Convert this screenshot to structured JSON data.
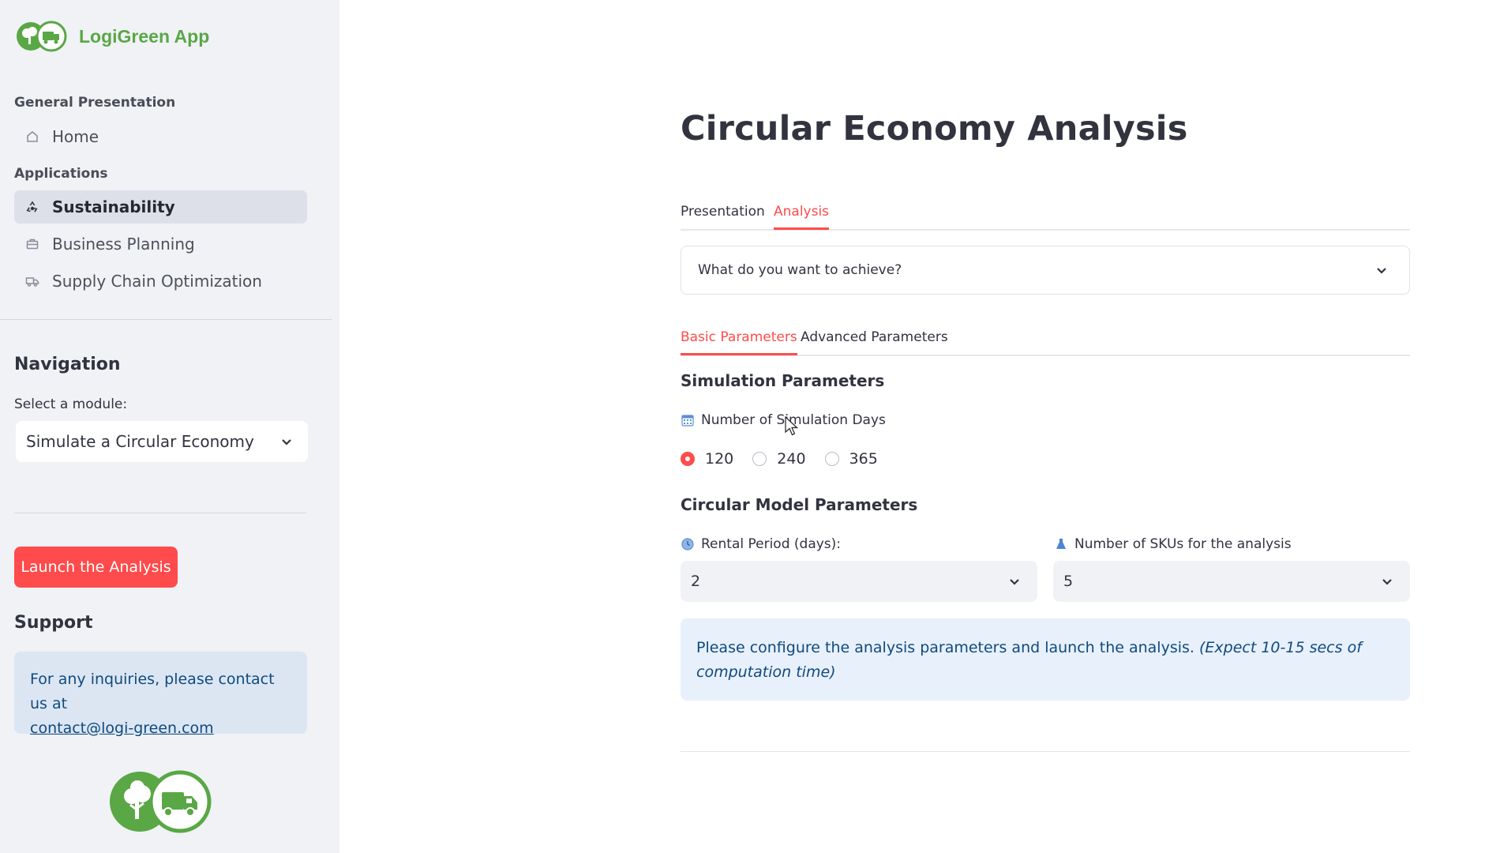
{
  "app": {
    "name": "LogiGreen App"
  },
  "sidebar": {
    "sections": [
      {
        "heading": "General Presentation"
      },
      {
        "heading": "Applications"
      }
    ],
    "items": [
      {
        "label": "Home",
        "icon": "home-icon",
        "active": false
      },
      {
        "label": "Sustainability",
        "icon": "recycle-icon",
        "active": true
      },
      {
        "label": "Business Planning",
        "icon": "briefcase-icon",
        "active": false
      },
      {
        "label": "Supply Chain Optimization",
        "icon": "truck-icon",
        "active": false
      }
    ],
    "navigation": {
      "title": "Navigation",
      "select_label": "Select a module:",
      "selected_module": "Simulate a Circular Economy"
    },
    "launch_label": "Launch the Analysis",
    "support": {
      "title": "Support",
      "text": "For any inquiries, please contact us at",
      "email": "contact@logi-green.com"
    }
  },
  "main": {
    "title": "Circular Economy Analysis",
    "tabs": [
      {
        "label": "Presentation",
        "active": false
      },
      {
        "label": "Analysis",
        "active": true
      }
    ],
    "expander": {
      "label": "What do you want to achieve?"
    },
    "param_tabs": [
      {
        "label": "Basic Parameters",
        "active": true
      },
      {
        "label": "Advanced Parameters",
        "active": false
      }
    ],
    "simulation": {
      "title": "Simulation Parameters",
      "days_label": "Number of Simulation Days",
      "options": [
        "120",
        "240",
        "365"
      ],
      "selected": "120"
    },
    "circular": {
      "title": "Circular Model Parameters",
      "rental_label": "Rental Period (days):",
      "rental_value": "2",
      "sku_label": "Number of SKUs for the analysis",
      "sku_value": "5"
    },
    "info": {
      "text": "Please configure the analysis parameters and launch the analysis.",
      "note": "(Expect 10-15 secs of computation time)"
    }
  },
  "colors": {
    "accent": "#ff4b4b",
    "brand_green": "#5aa745",
    "sidebar_bg": "#f0f2f6",
    "info_text": "#0f4a7f",
    "info_bg": "#e8f0fb"
  }
}
